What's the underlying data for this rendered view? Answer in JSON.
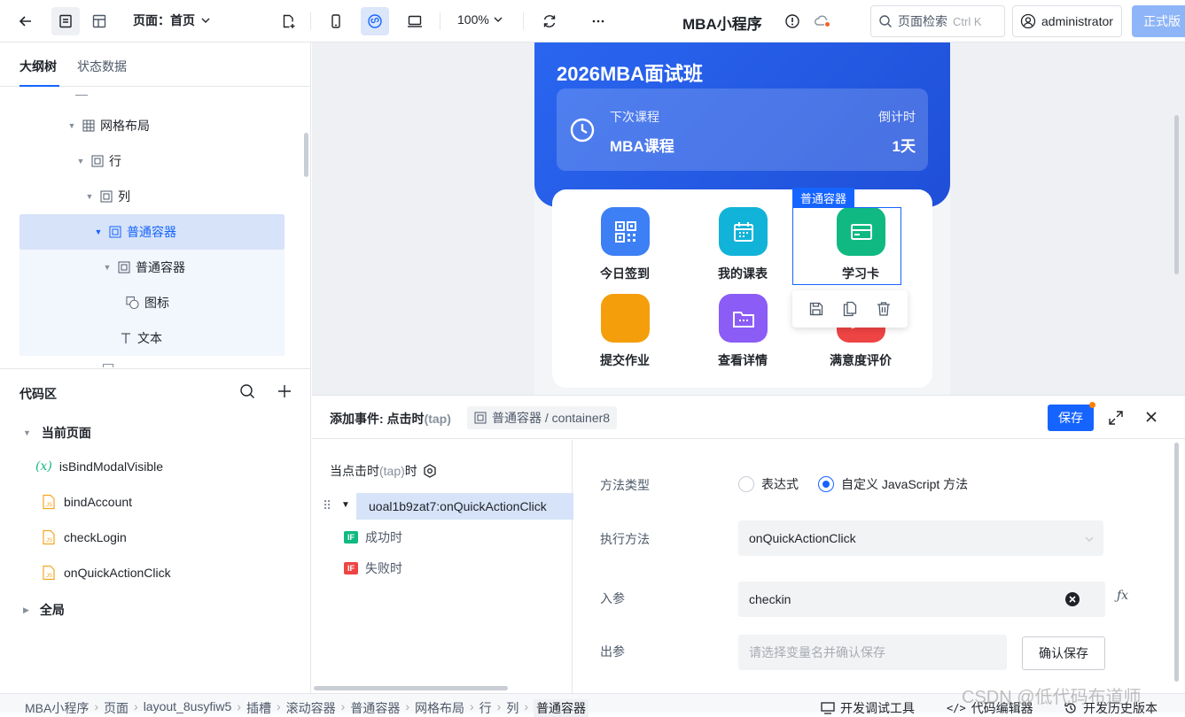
{
  "topbar": {
    "page_select": "页面：首页",
    "zoom": "100%",
    "app_title": "MBA小程序",
    "search_placeholder": "页面检索",
    "search_shortcut": "Ctrl K",
    "user": "administrator",
    "publish": "正式版"
  },
  "left": {
    "tabs": [
      "大纲树",
      "状态数据"
    ],
    "tree": [
      "网格布局",
      "行",
      "列",
      "普通容器",
      "普通容器",
      "图标",
      "文本"
    ],
    "code_title": "代码区",
    "current_page": "当前页面",
    "code_items": [
      "isBindModalVisible",
      "bindAccount",
      "checkLogin",
      "onQuickActionClick"
    ],
    "global": "全局"
  },
  "canvas": {
    "hero_title": "2026MBA面试班",
    "next_label": "下次课程",
    "next_value": "MBA课程",
    "countdown_label": "倒计时",
    "countdown_value": "1天",
    "selection_tag": "普通容器",
    "actions": [
      {
        "label": "今日签到",
        "color": "#3d7ff5",
        "icon": "qrcode-icon"
      },
      {
        "label": "我的课表",
        "color": "#12b3d8",
        "icon": "calendar-icon"
      },
      {
        "label": "学习卡",
        "color": "#10b981",
        "icon": "card-icon"
      },
      {
        "label": "提交作业",
        "color": "#f59e0b",
        "icon": "upload-icon"
      },
      {
        "label": "查看详情",
        "color": "#8b5cf6",
        "icon": "folder-icon"
      },
      {
        "label": "满意度评价",
        "color": "#ef4444",
        "icon": "chat-icon"
      }
    ]
  },
  "event": {
    "title": "添加事件: 点击时",
    "title_dim": "(tap)",
    "component": "普通容器 / container8",
    "save": "保存",
    "trigger_label": "当点击时",
    "trigger_dim": "(tap)",
    "trigger_suffix": "时",
    "action_item": "uoal1b9zat7:onQuickActionClick",
    "on_success": "成功时",
    "on_fail": "失败时",
    "method_type_label": "方法类型",
    "opt_expression": "表达式",
    "opt_custom_js": "自定义 JavaScript 方法",
    "exec_method_label": "执行方法",
    "exec_method_value": "onQuickActionClick",
    "input_label": "入参",
    "input_value": "checkin",
    "output_label": "出参",
    "output_placeholder": "请选择变量名并确认保存",
    "confirm_save": "确认保存"
  },
  "statusbar": {
    "crumbs": [
      "MBA小程序",
      "页面",
      "layout_8usyfiw5",
      "插槽",
      "滚动容器",
      "普通容器",
      "网格布局",
      "行",
      "列",
      "普通容器"
    ],
    "devtools": "开发调试工具",
    "code_editor": "代码编辑器",
    "history": "开发历史版本"
  },
  "watermark": "CSDN @低代码布道师"
}
